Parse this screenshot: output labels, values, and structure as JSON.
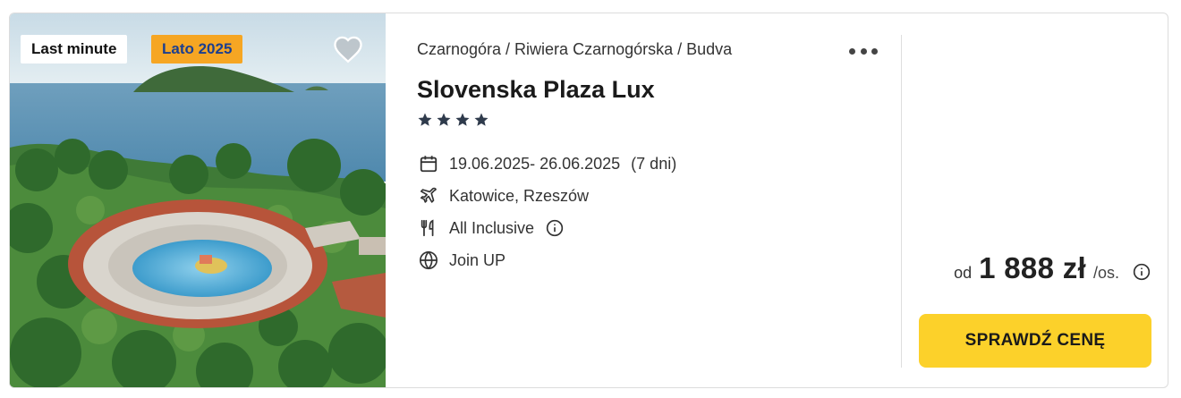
{
  "offer": {
    "badges": {
      "last_minute": "Last minute",
      "season": "Lato 2025"
    },
    "breadcrumb": "Czarnogóra / Riwiera Czarnogórska / Budva",
    "hotel_name": "Slovenska Plaza Lux",
    "stars": 4,
    "dates": "19.06.2025- 26.06.2025",
    "duration": "(7 dni)",
    "departure": "Katowice, Rzeszów",
    "board": "All Inclusive",
    "operator": "Join UP",
    "price": {
      "prefix": "od",
      "amount": "1 888 zł",
      "unit": "/os."
    },
    "cta_label": "SPRAWDŹ CENĘ"
  },
  "icons": [
    "heart-icon",
    "more-dots-icon",
    "star-icon",
    "calendar-icon",
    "plane-icon",
    "cutlery-icon",
    "info-icon",
    "globe-icon"
  ],
  "colors": {
    "badge_season_bg": "#f6a623",
    "badge_season_text": "#1c3f8f",
    "cta_bg": "#fcd12a",
    "star": "#2f3b4c"
  }
}
